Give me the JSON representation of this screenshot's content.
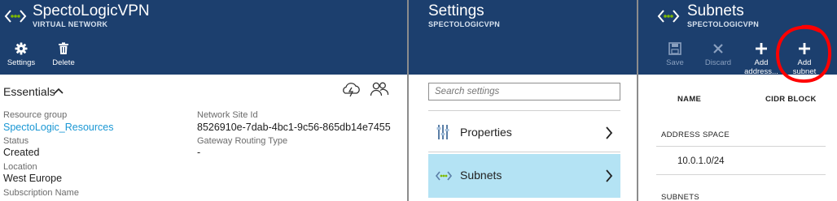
{
  "vnet_blade": {
    "title": "SpectoLogicVPN",
    "subtitle": "VIRTUAL NETWORK",
    "commands": [
      {
        "label": "Settings",
        "icon": "gear-icon"
      },
      {
        "label": "Delete",
        "icon": "trash-icon"
      }
    ],
    "essentials": {
      "title": "Essentials",
      "left": [
        {
          "label": "Resource group",
          "value": "SpectoLogic_Resources"
        },
        {
          "label": "Status",
          "value": "Created"
        },
        {
          "label": "Location",
          "value": "West Europe"
        },
        {
          "label": "Subscription Name",
          "value": ""
        }
      ],
      "right": [
        {
          "label": "Network Site Id",
          "value": "8526910e-7dab-4bc1-9c56-865db14e7455"
        },
        {
          "label": "Gateway Routing Type",
          "value": "-"
        }
      ]
    }
  },
  "settings_blade": {
    "title": "Settings",
    "subtitle": "SPECTOLOGICVPN",
    "search_placeholder": "Search settings",
    "items": [
      {
        "label": "Properties",
        "icon": "properties-icon"
      },
      {
        "label": "Subnets",
        "icon": "subnets-icon"
      }
    ]
  },
  "subnets_blade": {
    "title": "Subnets",
    "subtitle": "SPECTOLOGICVPN",
    "commands": [
      {
        "label": "Save",
        "icon": "save-icon"
      },
      {
        "label": "Discard",
        "icon": "discard-icon"
      },
      {
        "label": "Add address...",
        "line1": "Add",
        "line2": "address...",
        "icon": "add-icon"
      },
      {
        "label": "Add subnet",
        "line1": "Add",
        "line2": "subnet",
        "icon": "add-icon"
      }
    ],
    "columns": [
      "NAME",
      "CIDR BLOCK"
    ],
    "sections": [
      {
        "title": "ADDRESS SPACE",
        "rows": [
          "10.0.1.0/24"
        ]
      },
      {
        "title": "SUBNETS",
        "rows": []
      }
    ]
  },
  "colors": {
    "header_bg": "#1c3f6e",
    "link": "#1a97d4",
    "selected_item": "#b4e3f4",
    "highlight_circle": "#ff0000",
    "vnet_icon": "#7fba00"
  }
}
